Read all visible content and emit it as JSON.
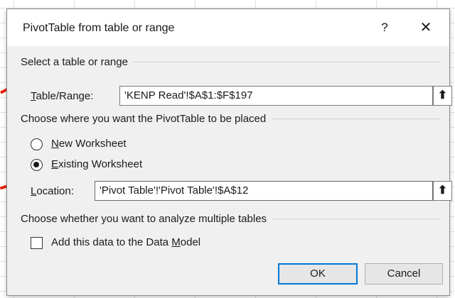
{
  "dialog": {
    "title": "PivotTable from table or range",
    "help_label": "?",
    "close_label": "✕"
  },
  "select_section": {
    "heading": "Select a table or range",
    "range_label_mnemonic": "T",
    "range_label_rest": "able/Range:",
    "range_value": "'KENP Read'!$A$1:$F$197",
    "collapse_icon": "⬆"
  },
  "placement_section": {
    "heading": "Choose where you want the PivotTable to be placed",
    "options": [
      {
        "mnemonic": "N",
        "rest": "ew Worksheet",
        "checked": false
      },
      {
        "mnemonic": "E",
        "rest": "xisting Worksheet",
        "checked": true
      }
    ],
    "location_label_mnemonic": "L",
    "location_label_rest": "ocation:",
    "location_value": "'Pivot Table'!'Pivot Table'!$A$12",
    "collapse_icon": "⬆"
  },
  "multiple_tables_section": {
    "heading": "Choose whether you want to analyze multiple tables",
    "checkbox_label_pre": "Add this data to the Data ",
    "checkbox_label_mnemonic": "M",
    "checkbox_label_post": "odel",
    "checked": false
  },
  "buttons": {
    "ok": "OK",
    "cancel": "Cancel"
  },
  "colors": {
    "annotation_arrow": "#e8220a",
    "default_button_border": "#0078d7"
  }
}
